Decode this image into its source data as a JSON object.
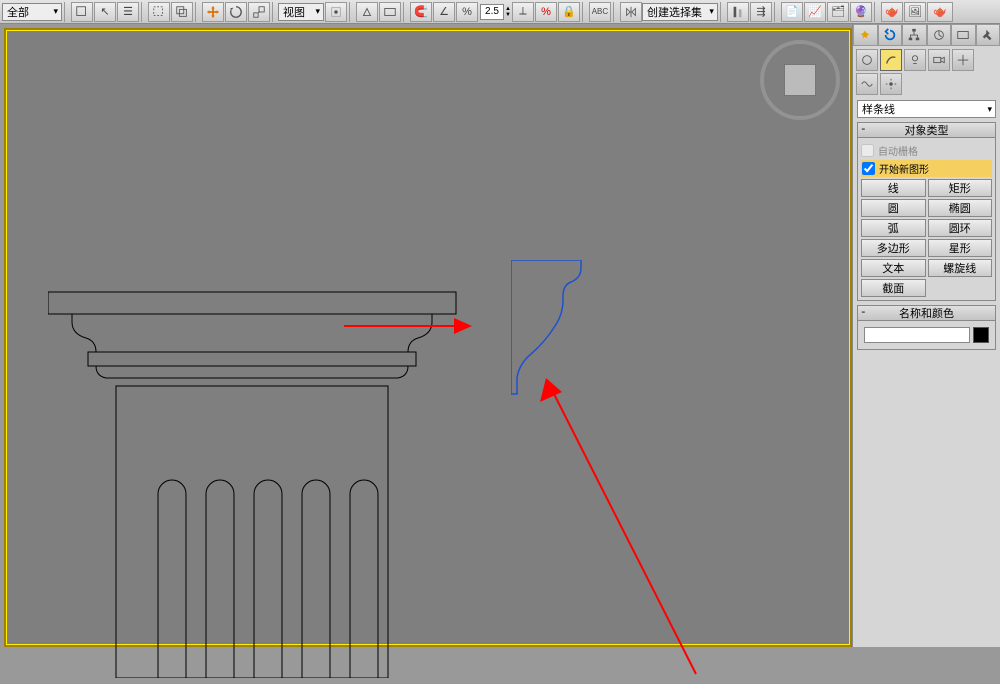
{
  "toolbar": {
    "filter_dropdown": "全部",
    "view_dropdown": "视图",
    "spinner_value": "2.5",
    "selset_dropdown": "创建选择集"
  },
  "panel": {
    "category_dropdown": "样条线",
    "rollout_object_type": "对象类型",
    "auto_grid": "自动栅格",
    "start_new_shape": "开始新图形",
    "shapes": {
      "line": "线",
      "rect": "矩形",
      "circle": "圆",
      "ellipse": "椭圆",
      "arc": "弧",
      "donut": "圆环",
      "ngon": "多边形",
      "star": "星形",
      "text": "文本",
      "helix": "螺旋线",
      "section": "截面",
      "empty": ""
    },
    "rollout_name_color": "名称和颜色"
  },
  "viewcube_face": ""
}
